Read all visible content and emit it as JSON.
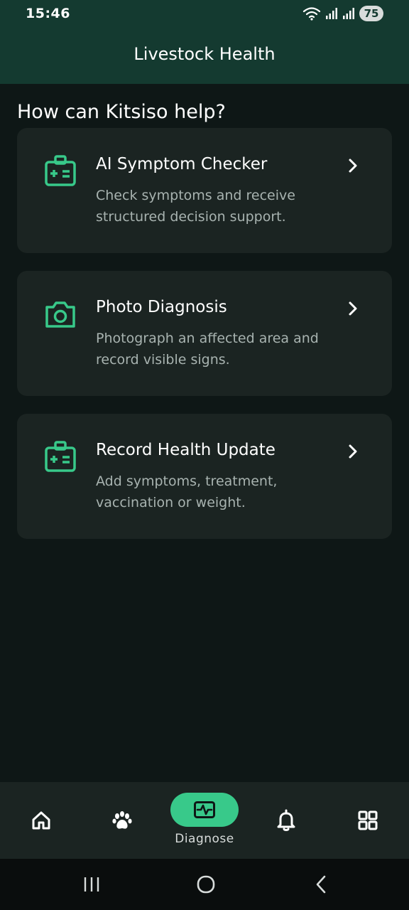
{
  "status_bar": {
    "time": "15:46",
    "battery": "75"
  },
  "header": {
    "title": "Livestock Health"
  },
  "main": {
    "section_title": "How can Kitsiso help?",
    "cards": [
      {
        "title": "AI Symptom Checker",
        "description": "Check symptoms and receive structured decision support.",
        "icon": "medical-kit-icon"
      },
      {
        "title": "Photo Diagnosis",
        "description": "Photograph an affected area and record visible signs.",
        "icon": "camera-icon"
      },
      {
        "title": "Record Health Update",
        "description": "Add symptoms, treatment, vaccination or weight.",
        "icon": "medical-kit-icon"
      }
    ]
  },
  "bottom_nav": {
    "items": [
      {
        "icon": "home-icon"
      },
      {
        "icon": "paw-icon"
      },
      {
        "icon": "heartbeat-icon",
        "label": "Diagnose",
        "active": true
      },
      {
        "icon": "bell-icon"
      },
      {
        "icon": "grid-icon"
      }
    ]
  },
  "colors": {
    "header_bg": "#143a30",
    "page_bg": "#0e1716",
    "card_bg": "#1b2422",
    "accent": "#38c98a",
    "muted_text": "#a8b3b0"
  }
}
